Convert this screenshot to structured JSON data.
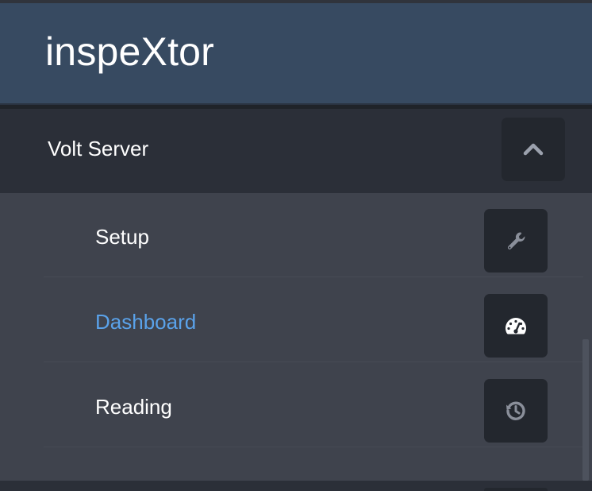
{
  "app": {
    "title": "inspeXtor"
  },
  "section": {
    "title": "Volt Server",
    "toggle_icon": "chevron-up-icon"
  },
  "menu": {
    "items": [
      {
        "label": "Setup",
        "icon": "wrench-icon",
        "active": false
      },
      {
        "label": "Dashboard",
        "icon": "speedometer-icon",
        "active": true
      },
      {
        "label": "Reading",
        "icon": "history-icon",
        "active": false
      }
    ]
  },
  "colors": {
    "header_bg": "#374a61",
    "section_bg": "#2b2f38",
    "submenu_bg": "#3f434d",
    "button_bg": "#23272e",
    "active_text": "#5aa2ea",
    "icon_muted": "#8a8f9a"
  }
}
